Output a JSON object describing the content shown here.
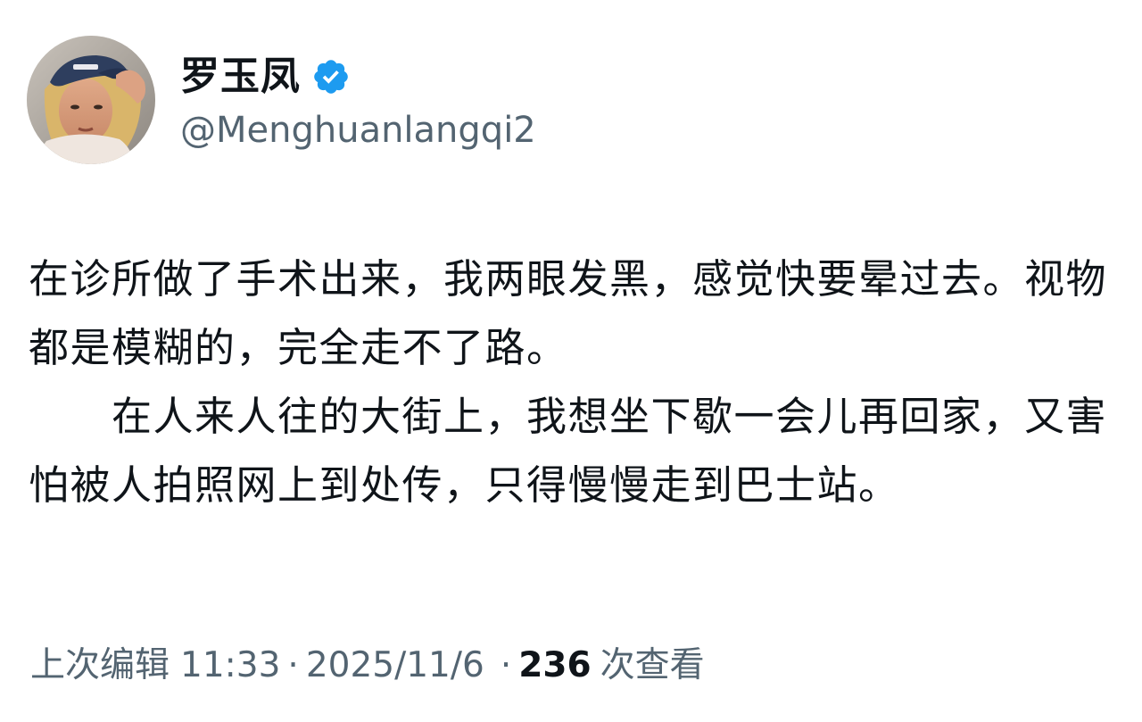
{
  "author": {
    "display_name": "罗玉凤",
    "handle": "@Menghuanlangqi2",
    "verified": true,
    "verified_color": "#1d9bf0",
    "avatar_icon": "profile-photo"
  },
  "tweet": {
    "paragraphs": [
      "在诊所做了手术出来，我两眼发黑，感觉快要晕过去。视物都是模糊的，完全走不了路。",
      "　　在人来人往的大街上，我想坐下歇一会儿再回家，又害怕被人拍照网上到处传，只得慢慢走到巴士站。"
    ]
  },
  "meta": {
    "edited_label": "上次编辑",
    "time": "11:33",
    "separator": "·",
    "date": "2025/11/6",
    "views_count": "236",
    "views_label": "次查看"
  },
  "colors": {
    "text_primary": "#0f1419",
    "text_secondary": "#536471",
    "background": "#ffffff"
  }
}
